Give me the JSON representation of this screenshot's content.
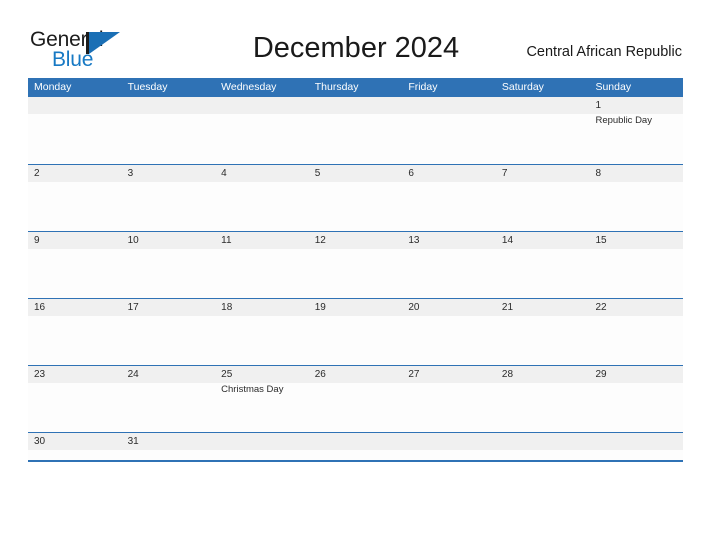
{
  "brand": {
    "word_one": "General",
    "word_two": "Blue",
    "mark_icon": "sail-triangle-icon"
  },
  "header": {
    "title": "December 2024",
    "region": "Central African Republic"
  },
  "theme": {
    "header_blue": "#2f72b5",
    "band_gray": "#f0f0f0",
    "brand_blue": "#1779c4",
    "text_dark": "#1a1a1a",
    "page_background": "#ffffff"
  },
  "calendar": {
    "weekdays": [
      "Monday",
      "Tuesday",
      "Wednesday",
      "Thursday",
      "Friday",
      "Saturday",
      "Sunday"
    ],
    "weeks": [
      {
        "short": false,
        "days": [
          {
            "number": "",
            "event": ""
          },
          {
            "number": "",
            "event": ""
          },
          {
            "number": "",
            "event": ""
          },
          {
            "number": "",
            "event": ""
          },
          {
            "number": "",
            "event": ""
          },
          {
            "number": "",
            "event": ""
          },
          {
            "number": "1",
            "event": "Republic Day"
          }
        ]
      },
      {
        "short": false,
        "days": [
          {
            "number": "2",
            "event": ""
          },
          {
            "number": "3",
            "event": ""
          },
          {
            "number": "4",
            "event": ""
          },
          {
            "number": "5",
            "event": ""
          },
          {
            "number": "6",
            "event": ""
          },
          {
            "number": "7",
            "event": ""
          },
          {
            "number": "8",
            "event": ""
          }
        ]
      },
      {
        "short": false,
        "days": [
          {
            "number": "9",
            "event": ""
          },
          {
            "number": "10",
            "event": ""
          },
          {
            "number": "11",
            "event": ""
          },
          {
            "number": "12",
            "event": ""
          },
          {
            "number": "13",
            "event": ""
          },
          {
            "number": "14",
            "event": ""
          },
          {
            "number": "15",
            "event": ""
          }
        ]
      },
      {
        "short": false,
        "days": [
          {
            "number": "16",
            "event": ""
          },
          {
            "number": "17",
            "event": ""
          },
          {
            "number": "18",
            "event": ""
          },
          {
            "number": "19",
            "event": ""
          },
          {
            "number": "20",
            "event": ""
          },
          {
            "number": "21",
            "event": ""
          },
          {
            "number": "22",
            "event": ""
          }
        ]
      },
      {
        "short": false,
        "days": [
          {
            "number": "23",
            "event": ""
          },
          {
            "number": "24",
            "event": ""
          },
          {
            "number": "25",
            "event": "Christmas Day"
          },
          {
            "number": "26",
            "event": ""
          },
          {
            "number": "27",
            "event": ""
          },
          {
            "number": "28",
            "event": ""
          },
          {
            "number": "29",
            "event": ""
          }
        ]
      },
      {
        "short": true,
        "days": [
          {
            "number": "30",
            "event": ""
          },
          {
            "number": "31",
            "event": ""
          },
          {
            "number": "",
            "event": ""
          },
          {
            "number": "",
            "event": ""
          },
          {
            "number": "",
            "event": ""
          },
          {
            "number": "",
            "event": ""
          },
          {
            "number": "",
            "event": ""
          }
        ]
      }
    ]
  }
}
